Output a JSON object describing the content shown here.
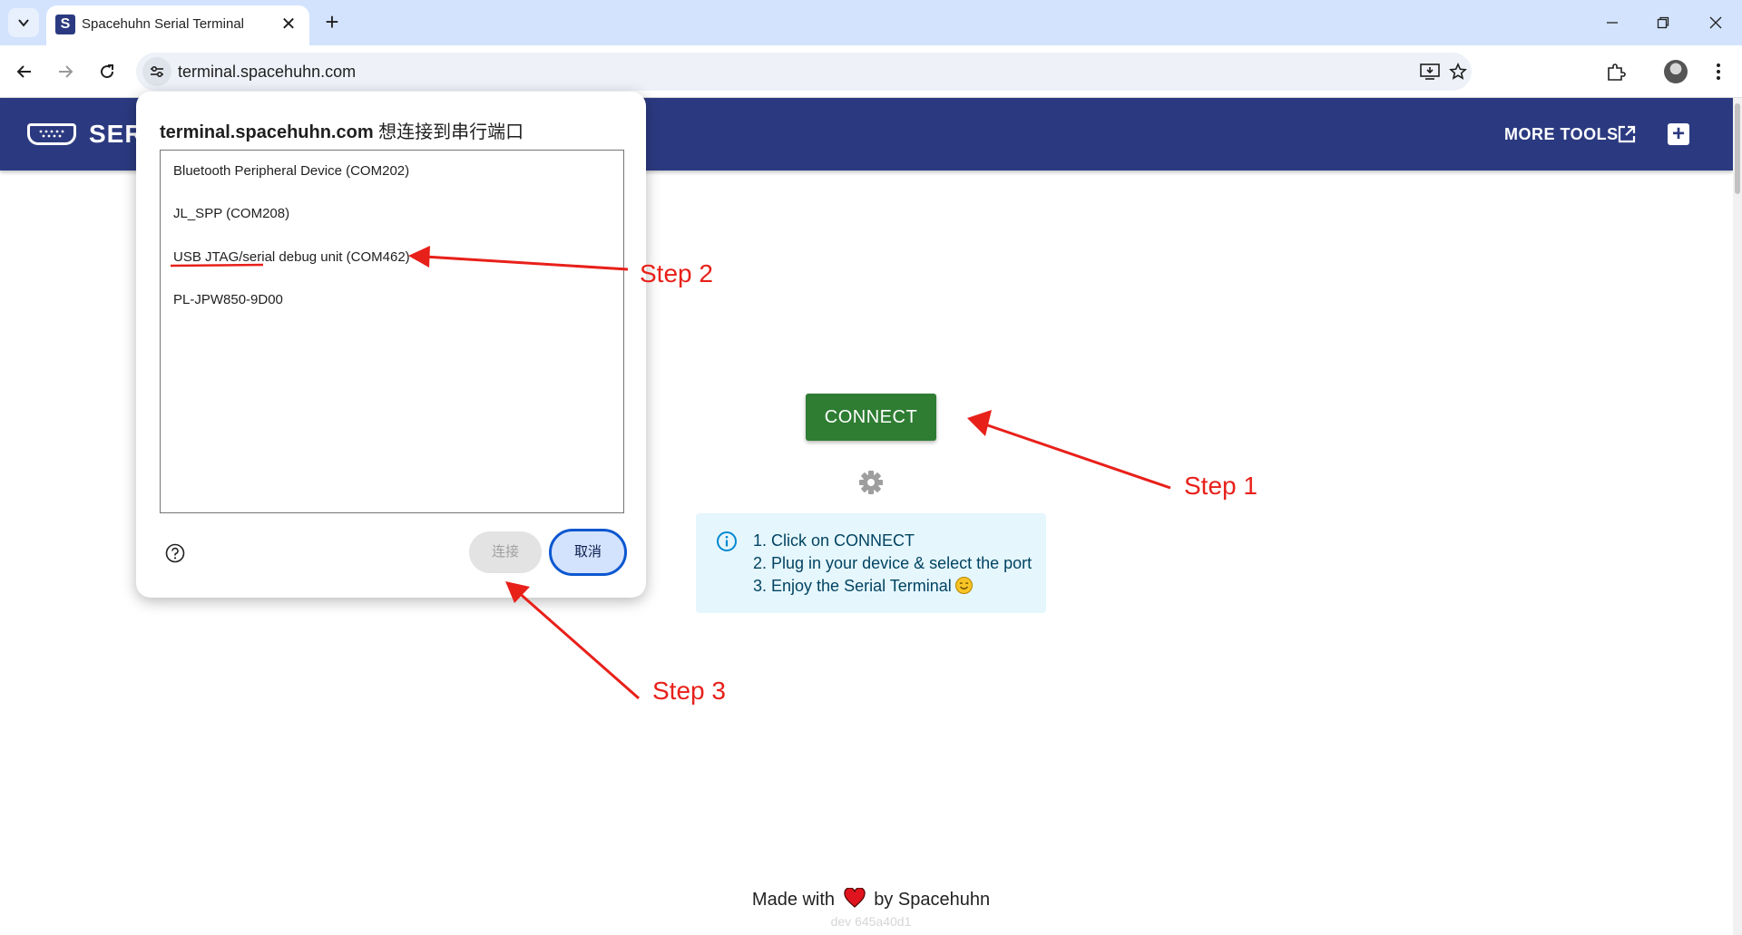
{
  "browser": {
    "tab_title": "Spacehuhn Serial Terminal",
    "tab_favicon_letter": "S",
    "url": "terminal.spacehuhn.com"
  },
  "header": {
    "logo_text": "SER",
    "more_tools_label": "MORE TOOLS"
  },
  "main": {
    "connect_label": "CONNECT",
    "info": {
      "line1": "1. Click on CONNECT",
      "line2": "2. Plug in your device & select the port",
      "line3": "3. Enjoy the Serial Terminal"
    }
  },
  "footer": {
    "made_with": "Made with",
    "by": "by Spacehuhn",
    "version": "dev 645a40d1"
  },
  "dialog": {
    "title_host": "terminal.spacehuhn.com",
    "title_suffix": " 想连接到串行端口",
    "ports": [
      "Bluetooth Peripheral Device (COM202)",
      "JL_SPP (COM208)",
      "USB JTAG/serial debug unit (COM462)",
      "PL-JPW850-9D00"
    ],
    "connect_label": "连接",
    "cancel_label": "取消"
  },
  "annotations": {
    "step1": "Step 1",
    "step2": "Step 2",
    "step3": "Step 3",
    "color": "#e8201a"
  },
  "colors": {
    "header_bg": "#2b3a80",
    "connect_bg": "#2e7d32",
    "info_bg": "#e5f6fd",
    "cancel_border": "#0b57d0"
  }
}
